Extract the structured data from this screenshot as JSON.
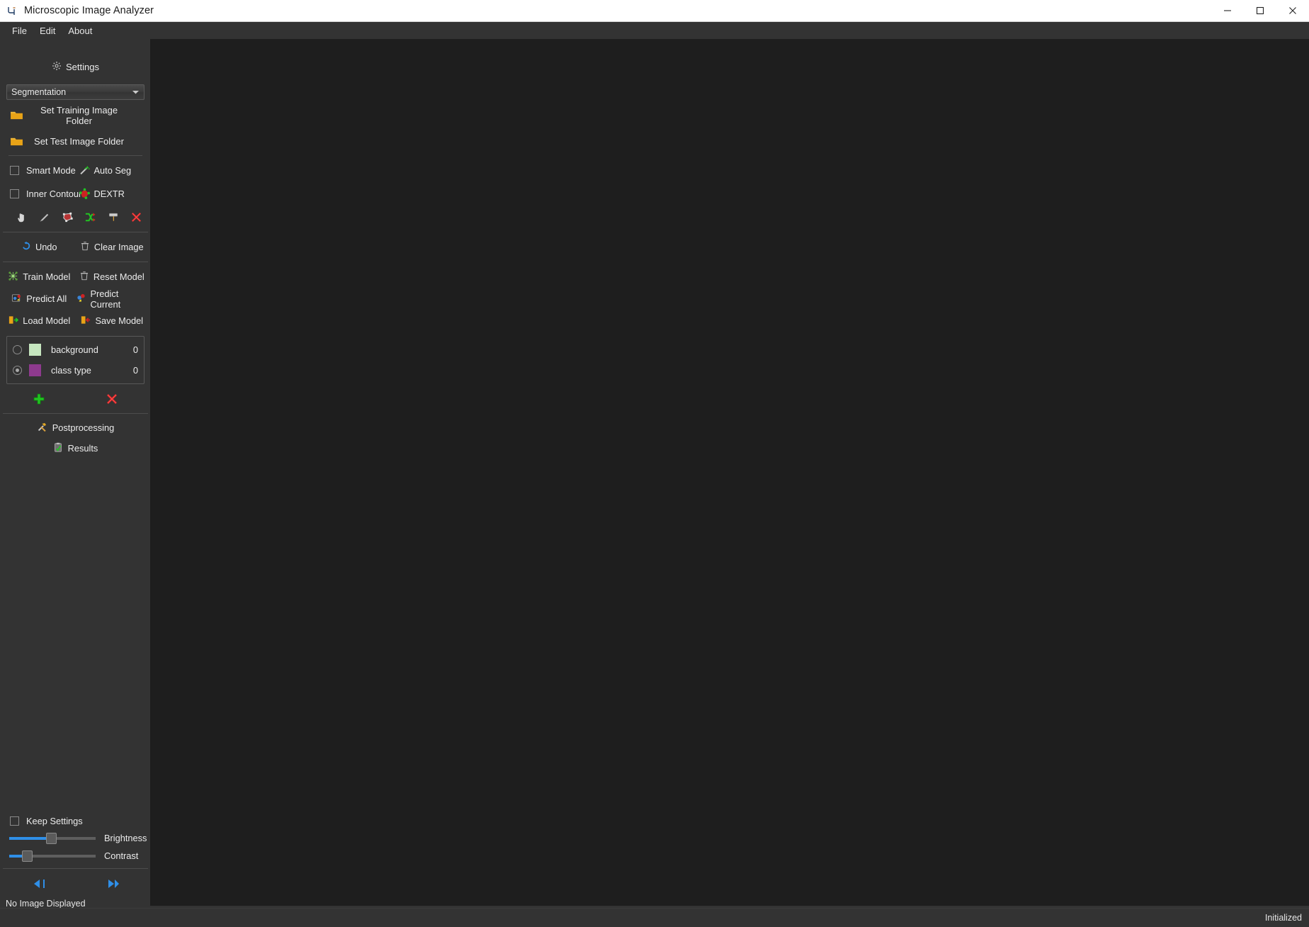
{
  "window": {
    "title": "Microscopic Image Analyzer",
    "icon": "app-logo-icon",
    "minimize": "minimize-icon",
    "maximize": "maximize-icon",
    "close": "close-icon"
  },
  "menubar": {
    "items": [
      {
        "label": "File"
      },
      {
        "label": "Edit"
      },
      {
        "label": "About"
      }
    ]
  },
  "sidebar": {
    "settings": {
      "label": "Settings",
      "icon": "gear-icon"
    },
    "mode_select": {
      "value": "Segmentation",
      "icon": "chevron-down-icon"
    },
    "folder_buttons": [
      {
        "label": "Set Training Image Folder",
        "icon": "folder-icon"
      },
      {
        "label": "Set Test Image Folder",
        "icon": "folder-icon"
      }
    ],
    "toggles": [
      {
        "label": "Smart Mode",
        "checked": false,
        "type": "checkbox"
      },
      {
        "label": "Auto Seg",
        "icon": "magic-wand-icon",
        "type": "button"
      },
      {
        "label": "Inner Contours",
        "checked": false,
        "type": "checkbox"
      },
      {
        "label": "DEXTR",
        "icon": "dextr-polygon-icon",
        "type": "button"
      }
    ],
    "tools": [
      {
        "name": "pointer-hand-icon"
      },
      {
        "name": "draw-line-icon"
      },
      {
        "name": "polygon-icon"
      },
      {
        "name": "merge-split-icon"
      },
      {
        "name": "paint-roller-icon"
      },
      {
        "name": "delete-x-icon"
      }
    ],
    "edit_buttons": [
      {
        "label": "Undo",
        "icon": "undo-icon"
      },
      {
        "label": "Clear Image",
        "icon": "trash-icon"
      }
    ],
    "model_buttons": [
      {
        "label": "Train Model",
        "icon": "train-model-icon"
      },
      {
        "label": "Reset Model",
        "icon": "trash-icon"
      },
      {
        "label": "Predict All",
        "icon": "predict-all-icon"
      },
      {
        "label": "Predict Current",
        "icon": "predict-current-icon"
      },
      {
        "label": "Load Model",
        "icon": "load-model-icon"
      },
      {
        "label": "Save Model",
        "icon": "save-model-icon"
      }
    ],
    "classes": [
      {
        "name": "background",
        "count": "0",
        "color": "#c6e6bf",
        "selected": false
      },
      {
        "name": "class type",
        "count": "0",
        "color": "#8e3a8e",
        "selected": true
      }
    ],
    "class_actions": [
      {
        "name": "add-class-icon"
      },
      {
        "name": "remove-class-icon"
      }
    ],
    "extra_buttons": [
      {
        "label": "Postprocessing",
        "icon": "tools-hammer-icon"
      },
      {
        "label": "Results",
        "icon": "results-clipboard-icon"
      }
    ],
    "keep_settings": {
      "label": "Keep Settings",
      "checked": false
    },
    "sliders": [
      {
        "label": "Brightness",
        "value": 48
      },
      {
        "label": "Contrast",
        "value": 20
      }
    ],
    "nav": [
      {
        "name": "previous-image-icon"
      },
      {
        "name": "next-image-icon"
      }
    ],
    "image_status": "No Image Displayed"
  },
  "statusbar": {
    "left": "",
    "right": "Initialized"
  },
  "colors": {
    "accent_blue": "#2f8fe8",
    "sidebar_bg": "#333333",
    "canvas_bg": "#1e1e1e"
  }
}
